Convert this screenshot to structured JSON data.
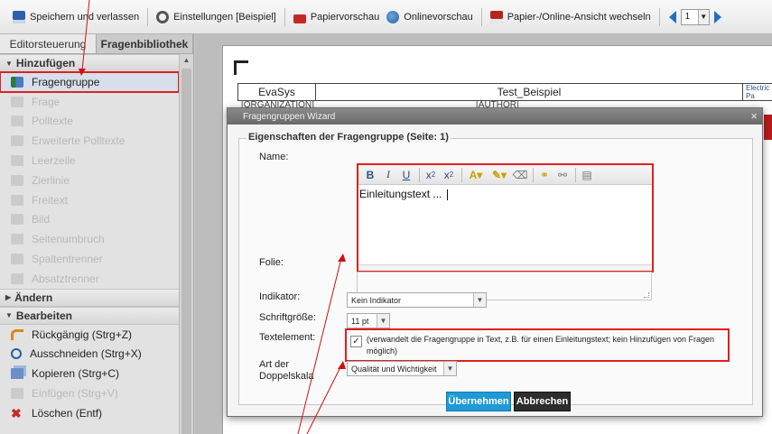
{
  "toolbar": {
    "save_exit": "Speichern und verlassen",
    "settings": "Einstellungen [Beispiel]",
    "paper_preview": "Papiervorschau",
    "online_preview": "Onlinevorschau",
    "switch_view": "Papier-/Online-Ansicht wechseln",
    "page_value": "1"
  },
  "leftpanel": {
    "tab_editor": "Editorsteuerung",
    "tab_library": "Fragenbibliothek",
    "section_add": "Hinzufügen",
    "add_items": [
      "Fragengruppe",
      "Frage",
      "Polltexte",
      "Erweiterte Polltexte",
      "Leerzeile",
      "Zierlinie",
      "Freitext",
      "Bild",
      "Seitenumbruch",
      "Spaltentrenner",
      "Absatztrenner"
    ],
    "section_change": "Ändern",
    "section_edit": "Bearbeiten",
    "edit_items": [
      "Rückgängig (Strg+Z)",
      "Ausschneiden (Strg+X)",
      "Kopieren (Strg+C)",
      "Einfügen (Strg+V)",
      "Löschen (Entf)"
    ]
  },
  "doc": {
    "cell1": "EvaSys",
    "cell2": "Test_Beispiel",
    "logo": "Electric Pa",
    "row2_left": "[ORGANIZATION]",
    "row2_mid": "[AUTHOR]"
  },
  "dialog": {
    "title": "Fragengruppen Wizard",
    "close": "×",
    "legend": "Eigenschaften der Fragengruppe (Seite: 1)",
    "label_name": "Name:",
    "editor_content": "Einleitungstext ... ",
    "label_folie": "Folie:",
    "label_indikator": "Indikator:",
    "indikator_value": "Kein Indikator",
    "label_schrift": "Schriftgröße:",
    "schrift_value": "11 pt",
    "label_textelement": "Textelement:",
    "textelement_checked": "✓",
    "textelement_desc": "(verwandelt die Fragengruppe in Text, z.B. für einen Einleitungstext; kein Hinzufügen von Fragen möglich)",
    "label_doppel": "Art der Doppelskala",
    "doppel_value": "Qualität und Wichtigkeit",
    "btn_ok": "Übernehmen",
    "btn_cancel": "Abbrechen"
  },
  "icons": {
    "editor_toolbar": [
      "bold-icon",
      "italic-icon",
      "underline-icon",
      "subscript-icon",
      "superscript-icon",
      "text-color-icon",
      "highlight-icon",
      "clear-format-icon",
      "link-icon",
      "unlink-icon",
      "paste-icon"
    ]
  },
  "colors": {
    "accent": "#1e9ad6",
    "annotation": "#e02020"
  }
}
